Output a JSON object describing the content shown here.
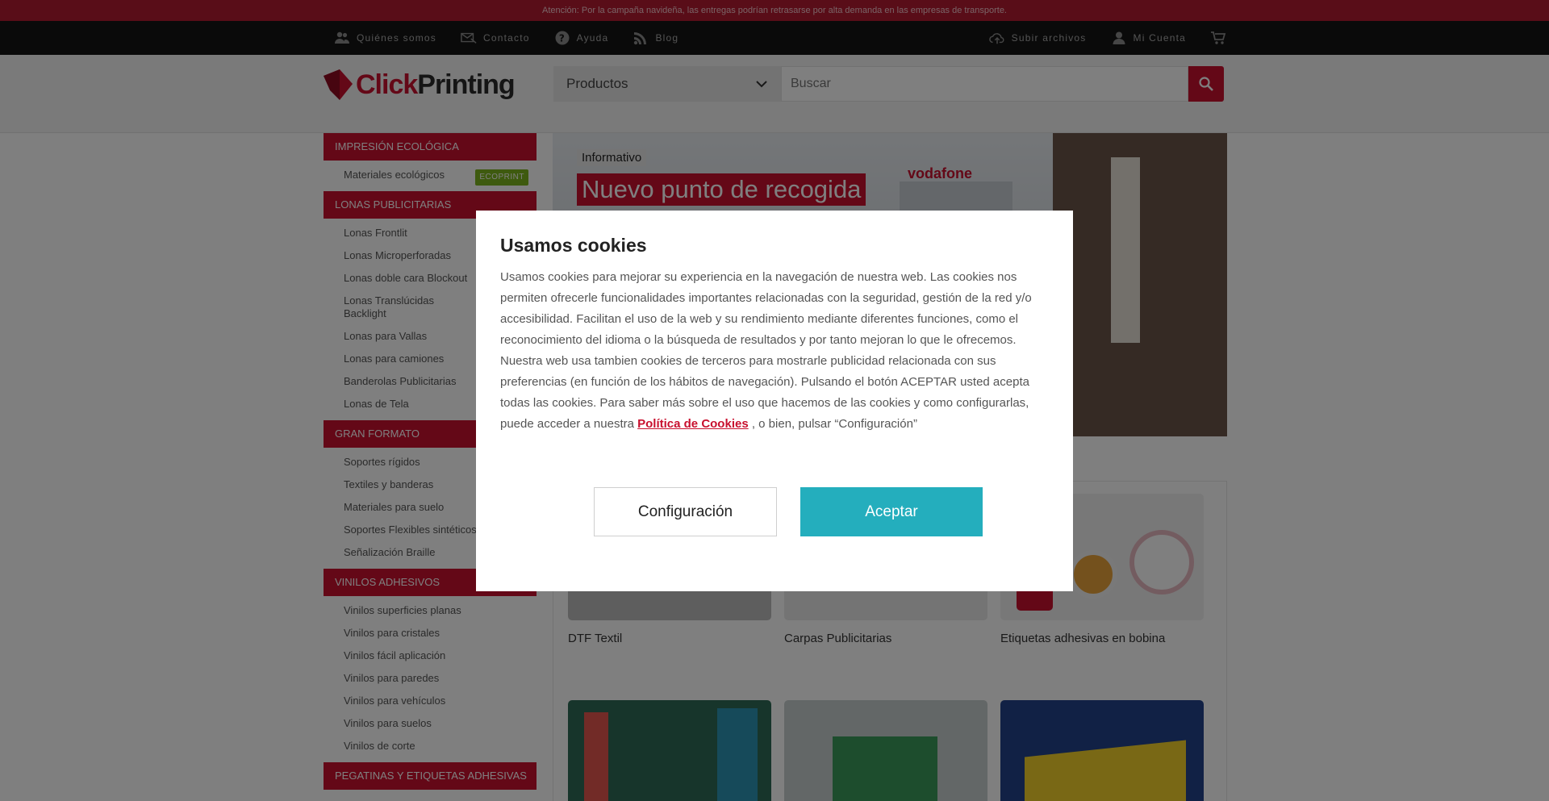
{
  "announcement": "Atención: Por la campaña navideña, las entregas podrían retrasarse por alta demanda en las empresas de transporte.",
  "topnav": {
    "left": [
      {
        "label": "Quiénes somos",
        "icon": "people-icon"
      },
      {
        "label": "Contacto",
        "icon": "contact-icon"
      },
      {
        "label": "Ayuda",
        "icon": "help-icon"
      },
      {
        "label": "Blog",
        "icon": "rss-icon"
      }
    ],
    "right": [
      {
        "label": "Subir archivos",
        "icon": "cloud-upload-icon"
      },
      {
        "label": "Mi Cuenta",
        "icon": "user-icon"
      }
    ]
  },
  "header": {
    "logo_click": "Click",
    "logo_printing": "Printing",
    "products_select": "Productos",
    "search_placeholder": "Buscar"
  },
  "colors": {
    "brand": "#c8102e",
    "accept": "#24aebd",
    "eco": "#7cb51e"
  },
  "sidebar": [
    {
      "title": "IMPRESIÓN ECOLÓGICA",
      "items": [
        {
          "label": "Materiales ecológicos",
          "badge": "ECOPRINT"
        }
      ]
    },
    {
      "title": "LONAS PUBLICITARIAS",
      "items": [
        {
          "label": "Lonas Frontlit"
        },
        {
          "label": "Lonas Microperforadas"
        },
        {
          "label": "Lonas doble cara Blockout"
        },
        {
          "label": "Lonas Translúcidas Backlight"
        },
        {
          "label": "Lonas para Vallas"
        },
        {
          "label": "Lonas para camiones"
        },
        {
          "label": "Banderolas Publicitarias"
        },
        {
          "label": "Lonas de Tela"
        }
      ]
    },
    {
      "title": "GRAN FORMATO",
      "items": [
        {
          "label": "Soportes rígidos"
        },
        {
          "label": "Textiles y banderas"
        },
        {
          "label": "Materiales para suelo"
        },
        {
          "label": "Soportes Flexibles sintéticos"
        },
        {
          "label": "Señalización Braille"
        }
      ]
    },
    {
      "title": "VINILOS ADHESIVOS",
      "items": [
        {
          "label": "Vinilos superficies planas"
        },
        {
          "label": "Vinilos para cristales"
        },
        {
          "label": "Vinilos fácil aplicación"
        },
        {
          "label": "Vinilos para paredes"
        },
        {
          "label": "Vinilos para vehículos"
        },
        {
          "label": "Vinilos para suelos"
        },
        {
          "label": "Vinilos de corte"
        }
      ]
    },
    {
      "title": "PEGATINAS Y ETIQUETAS ADHESIVAS",
      "items": []
    }
  ],
  "banner": {
    "tag": "Informativo",
    "title": "Nuevo punto de recogida",
    "sign": "vodafone"
  },
  "products": [
    {
      "label": "DTF Textil"
    },
    {
      "label": "Carpas Publicitarias"
    },
    {
      "label": "Etiquetas adhesivas en bobina"
    },
    {
      "label": ""
    },
    {
      "label": ""
    },
    {
      "label": ""
    }
  ],
  "cookie_modal": {
    "title": "Usamos cookies",
    "text_before": "Usamos cookies para mejorar su experiencia en la navegación de nuestra web. Las cookies nos permiten ofrecerle funcionalidades importantes relacionadas con la seguridad, gestión de la red y/o accesibilidad. Facilitan el uso de la web y su rendimiento mediante diferentes funciones, como el reconocimiento del idioma o la búsqueda de resultados y por tanto mejoran lo que le ofrecemos. Nuestra web usa tambien cookies de terceros para mostrarle publicidad relacionada con sus preferencias (en función de los hábitos de navegación). Pulsando el botón ACEPTAR usted acepta todas las cookies. Para saber más sobre el uso que hacemos de las cookies y como configurarlas, puede acceder a nuestra ",
    "link": "Política de Cookies",
    "text_after": " , o bien, pulsar “Configuración”",
    "config_button": "Configuración",
    "accept_button": "Aceptar"
  }
}
